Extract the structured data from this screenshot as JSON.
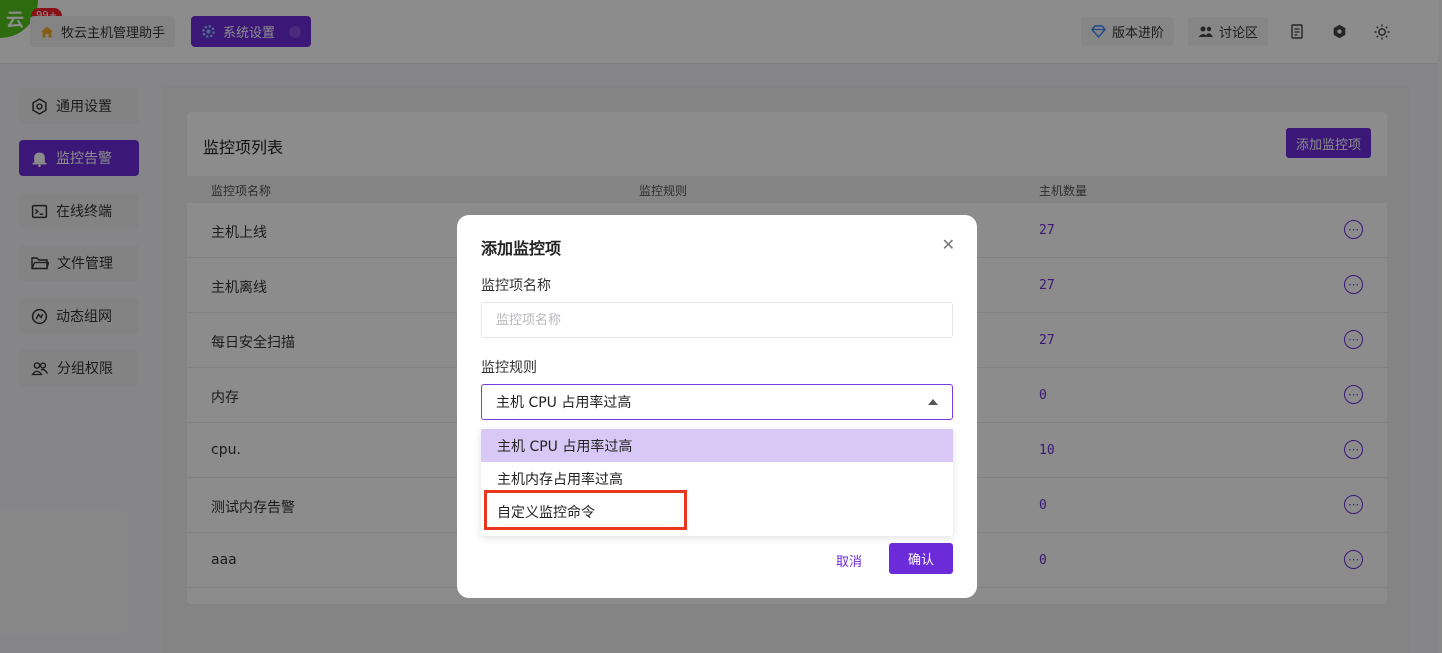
{
  "header": {
    "logo_glyph": "云",
    "badge": "99+",
    "tabs": [
      {
        "label": "牧云主机管理助手",
        "icon": "home-icon"
      },
      {
        "label": "系统设置",
        "icon": "gear-icon"
      }
    ],
    "right_buttons": [
      {
        "label": "版本进阶",
        "icon": "diamond-icon"
      },
      {
        "label": "讨论区",
        "icon": "users-icon"
      }
    ],
    "right_icons": [
      "document-icon",
      "settings-icon",
      "sun-icon"
    ]
  },
  "sidebar": {
    "items": [
      {
        "label": "通用设置",
        "icon": "hexagon-settings-icon"
      },
      {
        "label": "监控告警",
        "icon": "bell-icon",
        "active": true
      },
      {
        "label": "在线终端",
        "icon": "terminal-icon"
      },
      {
        "label": "文件管理",
        "icon": "folder-icon"
      },
      {
        "label": "动态组网",
        "icon": "network-icon"
      },
      {
        "label": "分组权限",
        "icon": "group-icon"
      }
    ]
  },
  "main": {
    "title": "监控项列表",
    "add_button": "添加监控项",
    "columns": [
      "监控项名称",
      "监控规则",
      "主机数量"
    ],
    "rows": [
      {
        "name": "主机上线",
        "count": "27"
      },
      {
        "name": "主机离线",
        "count": "27"
      },
      {
        "name": "每日安全扫描",
        "count": "27"
      },
      {
        "name": "内存",
        "count": "0"
      },
      {
        "name": "cpu.",
        "count": "10"
      },
      {
        "name": "测试内存告警",
        "count": "0"
      },
      {
        "name": "aaa",
        "count": "0"
      }
    ]
  },
  "modal": {
    "title": "添加监控项",
    "name_label": "监控项名称",
    "name_placeholder": "监控项名称",
    "name_value": "",
    "rule_label": "监控规则",
    "rule_selected": "主机 CPU 占用率过高",
    "options": [
      "主机 CPU 占用率过高",
      "主机内存占用率过高",
      "自定义监控命令"
    ],
    "cancel": "取消",
    "confirm": "确认"
  },
  "colors": {
    "accent": "#6c2bd9",
    "highlight_border": "#e8371e",
    "selected_option_bg": "#d9c8f5"
  }
}
